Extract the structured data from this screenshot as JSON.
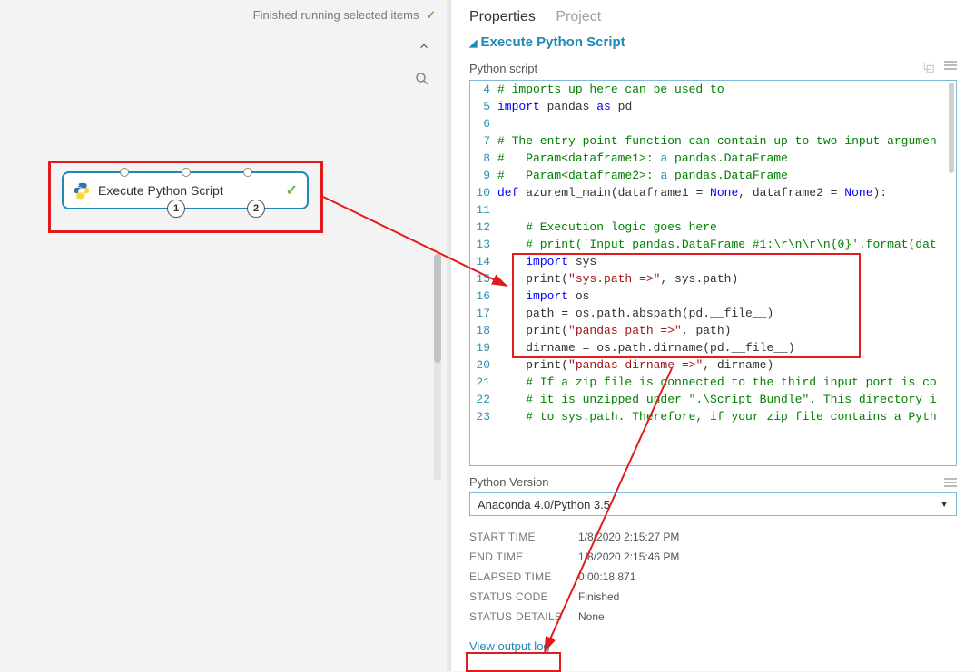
{
  "status": {
    "text": "Finished running selected items"
  },
  "node": {
    "title": "Execute Python Script",
    "out1": "1",
    "out2": "2"
  },
  "tabs": {
    "properties": "Properties",
    "project": "Project"
  },
  "section": {
    "title": "Execute Python Script"
  },
  "script_label": "Python script",
  "code": {
    "l4": "# imports up here can be used to",
    "l5a": "import",
    "l5b": " pandas ",
    "l5c": "as",
    "l5d": " pd",
    "l6": "",
    "l7": "# The entry point function can contain up to two input argumen",
    "l8a": "#   Param<dataframe1>:",
    "l8b": " a",
    "l8c": " pandas.DataFrame",
    "l9a": "#   Param<dataframe2>:",
    "l9b": " a",
    "l9c": " pandas.DataFrame",
    "l10a": "def",
    "l10b": " azureml_main(dataframe1 = ",
    "l10c": "None",
    "l10d": ", dataframe2 = ",
    "l10e": "None",
    "l10f": "):",
    "l11": "",
    "l12": "    # Execution logic goes here",
    "l13": "    # print('Input pandas.DataFrame #1:\\r\\n\\r\\n{0}'.format(dat",
    "l14a": "    ",
    "l14b": "import",
    "l14c": " sys",
    "l15a": "    print(",
    "l15b": "\"sys.path =>\"",
    "l15c": ", sys.path)",
    "l16a": "    ",
    "l16b": "import",
    "l16c": " os",
    "l17": "    path = os.path.abspath(pd.__file__)",
    "l18a": "    print(",
    "l18b": "\"pandas path =>\"",
    "l18c": ", path)",
    "l19": "    dirname = os.path.dirname(pd.__file__)",
    "l20a": "    print(",
    "l20b": "\"pandas dirname =>\"",
    "l20c": ", dirname)",
    "l21": "    # If a zip file is connected to the third input port is co",
    "l22": "    # it is unzipped under \".\\Script Bundle\". This directory i",
    "l23": "    # to sys.path. Therefore, if your zip file contains a Pyth",
    "n4": "4",
    "n5": "5",
    "n6": "6",
    "n7": "7",
    "n8": "8",
    "n9": "9",
    "n10": "10",
    "n11": "11",
    "n12": "12",
    "n13": "13",
    "n14": "14",
    "n15": "15",
    "n16": "16",
    "n17": "17",
    "n18": "18",
    "n19": "19",
    "n20": "20",
    "n21": "21",
    "n22": "22",
    "n23": "23"
  },
  "pv": {
    "label": "Python Version",
    "value": "Anaconda 4.0/Python 3.5"
  },
  "meta": {
    "start_k": "START TIME",
    "start_v": "1/8/2020 2:15:27 PM",
    "end_k": "END TIME",
    "end_v": "1/8/2020 2:15:46 PM",
    "elapsed_k": "ELAPSED TIME",
    "elapsed_v": "0:00:18.871",
    "status_k": "STATUS CODE",
    "status_v": "Finished",
    "details_k": "STATUS DETAILS",
    "details_v": "None"
  },
  "view_log": "View output log"
}
